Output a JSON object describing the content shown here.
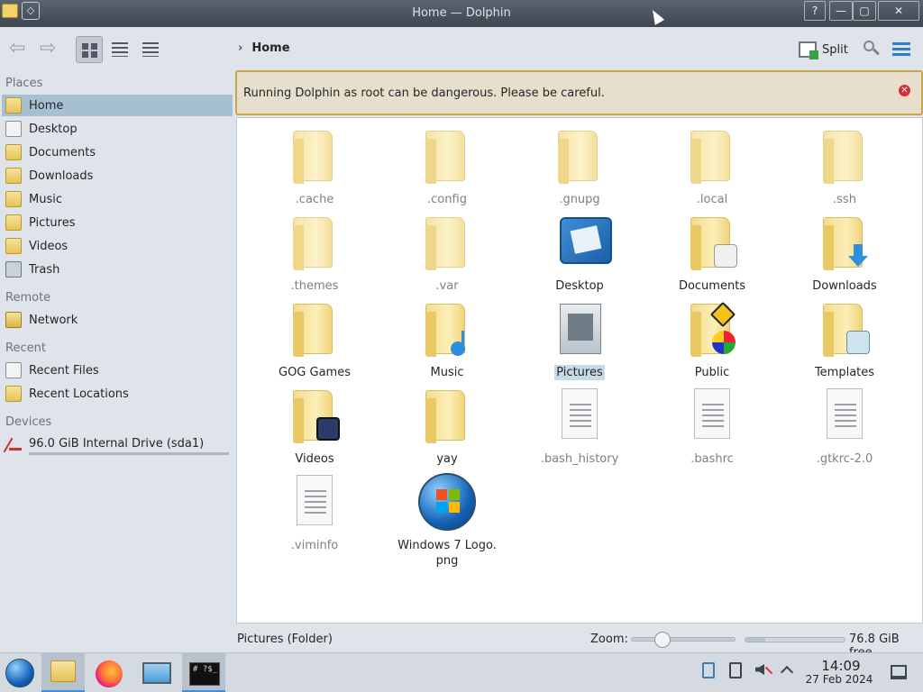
{
  "window": {
    "title": "Home — Dolphin",
    "help_label": "?",
    "minimize_label": "—",
    "maximize_label": "▢",
    "close_label": "✕"
  },
  "toolbar": {
    "breadcrumb": "Home",
    "split_label": "Split"
  },
  "banner": {
    "message": "Running Dolphin as root can be dangerous. Please be careful."
  },
  "sidebar": {
    "places_title": "Places",
    "places": [
      {
        "label": "Home",
        "icon": "home-folder-icon"
      },
      {
        "label": "Desktop",
        "icon": "desktop-icon"
      },
      {
        "label": "Documents",
        "icon": "documents-folder-icon"
      },
      {
        "label": "Downloads",
        "icon": "downloads-folder-icon"
      },
      {
        "label": "Music",
        "icon": "music-folder-icon"
      },
      {
        "label": "Pictures",
        "icon": "pictures-folder-icon"
      },
      {
        "label": "Videos",
        "icon": "videos-folder-icon"
      },
      {
        "label": "Trash",
        "icon": "trash-icon"
      }
    ],
    "remote_title": "Remote",
    "remote": [
      {
        "label": "Network",
        "icon": "network-folder-icon"
      }
    ],
    "recent_title": "Recent",
    "recent": [
      {
        "label": "Recent Files",
        "icon": "recent-files-icon"
      },
      {
        "label": "Recent Locations",
        "icon": "recent-locations-icon"
      }
    ],
    "devices_title": "Devices",
    "devices": [
      {
        "label": "96.0 GiB Internal Drive (sda1)",
        "icon": "drive-icon"
      }
    ]
  },
  "files": [
    {
      "name": ".cache",
      "type": "folder"
    },
    {
      "name": ".config",
      "type": "folder"
    },
    {
      "name": ".gnupg",
      "type": "folder"
    },
    {
      "name": ".local",
      "type": "folder"
    },
    {
      "name": ".ssh",
      "type": "folder"
    },
    {
      "name": ".themes",
      "type": "folder"
    },
    {
      "name": ".var",
      "type": "folder"
    },
    {
      "name": "Desktop",
      "type": "folder"
    },
    {
      "name": "Documents",
      "type": "folder"
    },
    {
      "name": "Downloads",
      "type": "folder"
    },
    {
      "name": "GOG Games",
      "type": "folder"
    },
    {
      "name": "Music",
      "type": "folder"
    },
    {
      "name": "Pictures",
      "type": "folder"
    },
    {
      "name": "Public",
      "type": "folder"
    },
    {
      "name": "Templates",
      "type": "folder"
    },
    {
      "name": "Videos",
      "type": "folder"
    },
    {
      "name": "yay",
      "type": "folder"
    },
    {
      "name": ".bash_history",
      "type": "file"
    },
    {
      "name": ".bashrc",
      "type": "file"
    },
    {
      "name": ".gtkrc-2.0",
      "type": "file"
    },
    {
      "name": ".viminfo",
      "type": "file"
    },
    {
      "name": "Windows 7 Logo.\npng",
      "type": "image"
    }
  ],
  "status": {
    "selection": "Pictures (Folder)",
    "zoom_label": "Zoom:",
    "zoom_level": 0.22,
    "free_space": "76.8 GiB free",
    "used_fraction": 0.2
  },
  "taskbar": {
    "terminal_text": "# ?$_",
    "time": "14:09",
    "date": "27 Feb 2024"
  },
  "colors": {
    "accent": "#3a8ee6",
    "selection": "#a7c0d1",
    "banner_border": "#c7a74a",
    "banner_close": "#d92e3a"
  }
}
